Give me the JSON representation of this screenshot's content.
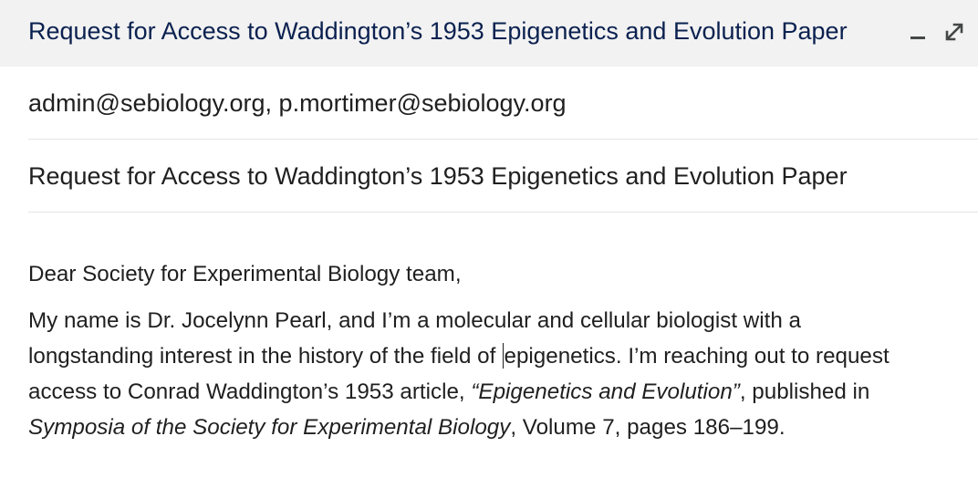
{
  "window": {
    "title": "Request for Access to Waddington’s 1953 Epigenetics and Evolution Paper",
    "minimize_icon": "minimize-icon",
    "expand_icon": "expand-icon"
  },
  "recipients": "admin@sebiology.org, p.mortimer@sebiology.org",
  "subject": "Request for Access to Waddington’s 1953 Epigenetics and Evolution Paper",
  "body": {
    "greeting": "Dear Society for Experimental Biology team,",
    "paragraph": {
      "line1": "My name is Dr. Jocelynn Pearl, and I’m a molecular and cellular biologist with a",
      "line2_before_caret": "longstanding interest in the history of the field of ",
      "line2_after_caret": "epigenetics. I’m reaching out to request",
      "line3_start": "access to Conrad Waddington’s 1953 article, ",
      "article_title": "“Epigenetics and Evolution”",
      "line3_end": ", published in",
      "journal": "Symposia of the Society for Experimental Biology",
      "line4_end": ", Volume 7, pages 186–199."
    }
  }
}
